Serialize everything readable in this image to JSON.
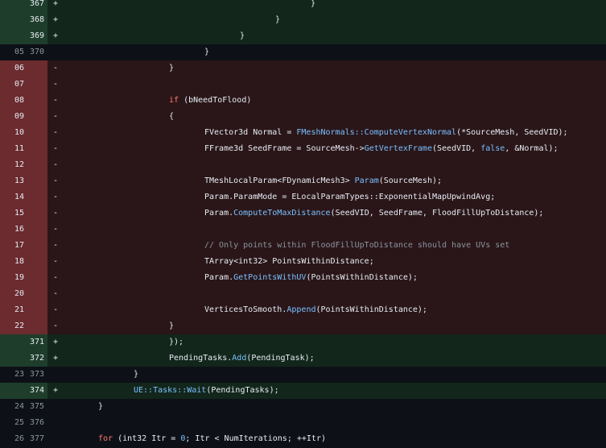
{
  "diff": {
    "rows": [
      {
        "type": "add",
        "old": "",
        "new": "367",
        "sign": "+",
        "indent": 386,
        "parts": [
          {
            "t": "}"
          }
        ]
      },
      {
        "type": "add",
        "old": "",
        "new": "368",
        "sign": "+",
        "indent": 342,
        "parts": [
          {
            "t": "}"
          }
        ]
      },
      {
        "type": "add",
        "old": "",
        "new": "369",
        "sign": "+",
        "indent": 298,
        "parts": [
          {
            "t": "}"
          }
        ]
      },
      {
        "type": "ctx",
        "old": "05",
        "new": "370",
        "sign": "",
        "indent": 254,
        "parts": [
          {
            "t": "}"
          }
        ]
      },
      {
        "type": "del",
        "old": "06",
        "new": "",
        "sign": "-",
        "indent": 210,
        "parts": [
          {
            "t": "}"
          }
        ]
      },
      {
        "type": "del",
        "old": "07",
        "new": "",
        "sign": "-",
        "indent": 210,
        "parts": []
      },
      {
        "type": "del",
        "old": "08",
        "new": "",
        "sign": "-",
        "indent": 210,
        "parts": [
          {
            "t": "if",
            "c": "kw"
          },
          {
            "t": " (bNeedToFlood)"
          }
        ]
      },
      {
        "type": "del",
        "old": "09",
        "new": "",
        "sign": "-",
        "indent": 210,
        "parts": [
          {
            "t": "{"
          }
        ]
      },
      {
        "type": "del",
        "old": "10",
        "new": "",
        "sign": "-",
        "indent": 254,
        "parts": [
          {
            "t": "FVector3d Normal = "
          },
          {
            "t": "FMeshNormals::ComputeVertexNormal",
            "c": "fn"
          },
          {
            "t": "(*SourceMesh, SeedVID);"
          }
        ]
      },
      {
        "type": "del",
        "old": "11",
        "new": "",
        "sign": "-",
        "indent": 254,
        "parts": [
          {
            "t": "FFrame3d SeedFrame = SourceMesh->"
          },
          {
            "t": "GetVertexFrame",
            "c": "fn"
          },
          {
            "t": "(SeedVID, "
          },
          {
            "t": "false",
            "c": "fn"
          },
          {
            "t": ", &Normal);"
          }
        ]
      },
      {
        "type": "del",
        "old": "12",
        "new": "",
        "sign": "-",
        "indent": 254,
        "parts": []
      },
      {
        "type": "del",
        "old": "13",
        "new": "",
        "sign": "-",
        "indent": 254,
        "parts": [
          {
            "t": "TMeshLocalParam<FDynamicMesh3> "
          },
          {
            "t": "Param",
            "c": "fn"
          },
          {
            "t": "(SourceMesh);"
          }
        ]
      },
      {
        "type": "del",
        "old": "14",
        "new": "",
        "sign": "-",
        "indent": 254,
        "parts": [
          {
            "t": "Param.ParamMode = ELocalParamTypes::ExponentialMapUpwindAvg;"
          }
        ]
      },
      {
        "type": "del",
        "old": "15",
        "new": "",
        "sign": "-",
        "indent": 254,
        "parts": [
          {
            "t": "Param."
          },
          {
            "t": "ComputeToMaxDistance",
            "c": "fn"
          },
          {
            "t": "(SeedVID, SeedFrame, FloodFillUpToDistance);"
          }
        ]
      },
      {
        "type": "del",
        "old": "16",
        "new": "",
        "sign": "-",
        "indent": 254,
        "parts": []
      },
      {
        "type": "del",
        "old": "17",
        "new": "",
        "sign": "-",
        "indent": 254,
        "parts": [
          {
            "t": "// Only points within FloodFillUpToDistance should have UVs set",
            "c": "cm"
          }
        ]
      },
      {
        "type": "del",
        "old": "18",
        "new": "",
        "sign": "-",
        "indent": 254,
        "parts": [
          {
            "t": "TArray<int32> PointsWithinDistance;"
          }
        ]
      },
      {
        "type": "del",
        "old": "19",
        "new": "",
        "sign": "-",
        "indent": 254,
        "parts": [
          {
            "t": "Param."
          },
          {
            "t": "GetPointsWithUV",
            "c": "fn"
          },
          {
            "t": "(PointsWithinDistance);"
          }
        ]
      },
      {
        "type": "del",
        "old": "20",
        "new": "",
        "sign": "-",
        "indent": 254,
        "parts": []
      },
      {
        "type": "del",
        "old": "21",
        "new": "",
        "sign": "-",
        "indent": 254,
        "parts": [
          {
            "t": "VerticesToSmooth."
          },
          {
            "t": "Append",
            "c": "fn"
          },
          {
            "t": "(PointsWithinDistance);"
          }
        ]
      },
      {
        "type": "del",
        "old": "22",
        "new": "",
        "sign": "-",
        "indent": 210,
        "parts": [
          {
            "t": "}"
          }
        ]
      },
      {
        "type": "add",
        "old": "",
        "new": "371",
        "sign": "+",
        "indent": 210,
        "parts": [
          {
            "t": "});"
          }
        ]
      },
      {
        "type": "add",
        "old": "",
        "new": "372",
        "sign": "+",
        "indent": 210,
        "parts": [
          {
            "t": "PendingTasks."
          },
          {
            "t": "Add",
            "c": "fn"
          },
          {
            "t": "(PendingTask);"
          }
        ]
      },
      {
        "type": "ctx",
        "old": "23",
        "new": "373",
        "sign": "",
        "indent": 166,
        "parts": [
          {
            "t": "}"
          }
        ]
      },
      {
        "type": "add",
        "old": "",
        "new": "374",
        "sign": "+",
        "indent": 166,
        "parts": [
          {
            "t": "UE::Tasks::Wait",
            "c": "fn"
          },
          {
            "t": "(PendingTasks);"
          }
        ]
      },
      {
        "type": "ctx",
        "old": "24",
        "new": "375",
        "sign": "",
        "indent": 122,
        "parts": [
          {
            "t": "}"
          }
        ]
      },
      {
        "type": "ctx",
        "old": "25",
        "new": "376",
        "sign": "",
        "indent": 122,
        "parts": []
      },
      {
        "type": "ctx",
        "old": "26",
        "new": "377",
        "sign": "",
        "indent": 122,
        "parts": [
          {
            "t": "for",
            "c": "kw"
          },
          {
            "t": " (int32 Itr = "
          },
          {
            "t": "0",
            "c": "fn"
          },
          {
            "t": "; Itr < NumIterations; ++Itr)"
          }
        ]
      }
    ]
  }
}
